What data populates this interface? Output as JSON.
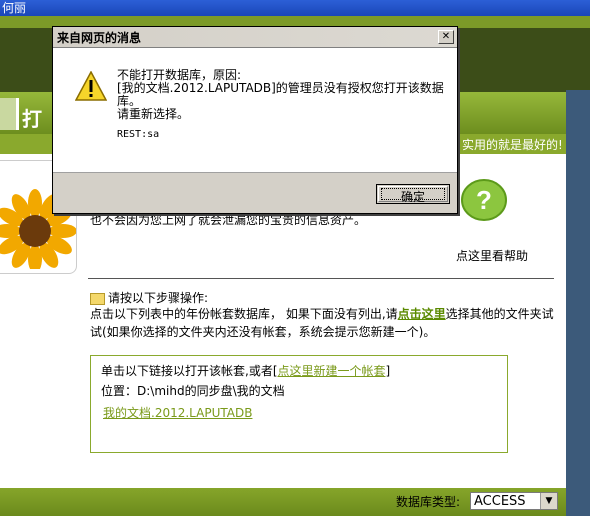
{
  "window": {
    "title_fragment": "何丽"
  },
  "panel": {
    "title": "打",
    "slogan": "实用的就是最好的!",
    "info_line": "也不会因为您上网了就会泄漏您的宝贵的信息资产。",
    "help_text": "点这里看帮助",
    "steps_heading": "请按以下步骤操作:",
    "steps_text_1": "点击以下列表中的年份帐套数据库，   如果下面没有列出,请",
    "steps_link": "点击这里",
    "steps_text_2": "选择其他的文件夹试试(如果你选择的文件夹内还没有帐套，系统会提示您新建一个)。",
    "linkbox": {
      "line1_prefix": "单击以下链接以打开该帐套,或者[",
      "line1_link": "点这里新建一个帐套",
      "line1_suffix": "]",
      "location": "位置：D:\\mihd的同步盘\\我的文档",
      "file_link": "我的文档.2012.LAPUTADB"
    },
    "db_type_label": "数据库类型:",
    "db_type_value": "ACCESS"
  },
  "dialog": {
    "title": "来自网页的消息",
    "close_glyph": "✕",
    "message_line1": "不能打开数据库，原因:",
    "message_line2": "[我的文档.2012.LAPUTADB]的管理员没有授权您打开该数据",
    "message_line3": "库。",
    "message_line4": "请重新选择。",
    "rest": "REST:sa",
    "ok_label": "确定"
  },
  "icons": {
    "warning": "warning-icon",
    "help": "question-help-icon",
    "folder": "folder-icon",
    "close": "close-icon",
    "dropdown": "chevron-down-icon"
  },
  "colors": {
    "accent_green": "#7c9a28",
    "link_green": "#5a8a00"
  }
}
